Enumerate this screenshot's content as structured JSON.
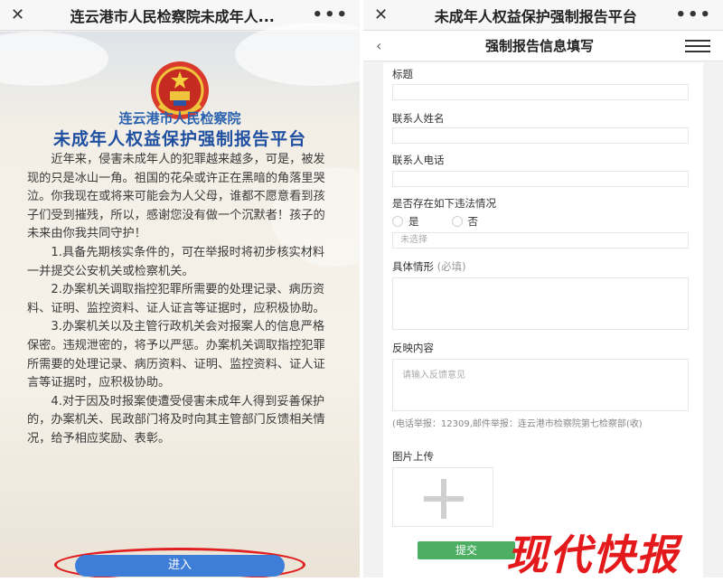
{
  "left": {
    "window_title": "连云港市人民检察院未成年人...",
    "close_icon": "close-icon",
    "more_icon": "more-icon",
    "org_name": "连云港市人民检察院",
    "platform_title": "未成年人权益保护强制报告平台",
    "intro": [
      "近年来，侵害未成年人的犯罪越来越多，可是，被发现的只是冰山一角。祖国的花朵或许正在黑暗的角落里哭泣。你我现在或将来可能会为人父母，谁都不愿意看到孩子们受到摧残，所以，感谢您没有做一个沉默者！孩子的未来由你我共同守护！",
      "1.具备先期核实条件的，可在举报时将初步核实材料一并提交公安机关或检察机关。",
      "2.办案机关调取指控犯罪所需要的处理记录、病历资料、证明、监控资料、证人证言等证据时，应积极协助。",
      "3.办案机关以及主管行政机关会对报案人的信息严格保密。违规泄密的，将予以严惩。办案机关调取指控犯罪所需要的处理记录、病历资料、证明、监控资料、证人证言等证据时，应积极协助。",
      "4.对于因及时报案使遭受侵害未成年人得到妥善保护的，办案机关、民政部门将及时向其主管部门反馈相关情况，给予相应奖励、表彰。"
    ],
    "enter_button": "进入"
  },
  "right": {
    "window_title": "未成年人权益保护强制报告平台",
    "page_title": "强制报告信息填写",
    "back_icon": "back-icon",
    "menu_icon": "menu-icon",
    "fields": {
      "title_label": "标题",
      "name_label": "联系人姓名",
      "phone_label": "联系人电话",
      "violation_label": "是否存在如下违法情况",
      "yes": "是",
      "no": "否",
      "select_placeholder": "未选择",
      "detail_label": "具体情形",
      "detail_required": "(必填)",
      "feedback_label": "反映内容",
      "feedback_placeholder": "请输入反馈意见",
      "note": "(电话举报：12309,邮件举报：连云港市检察院第七检察部(收)",
      "upload_label": "图片上传"
    },
    "submit_button": "提交"
  },
  "watermark": "现代快报"
}
